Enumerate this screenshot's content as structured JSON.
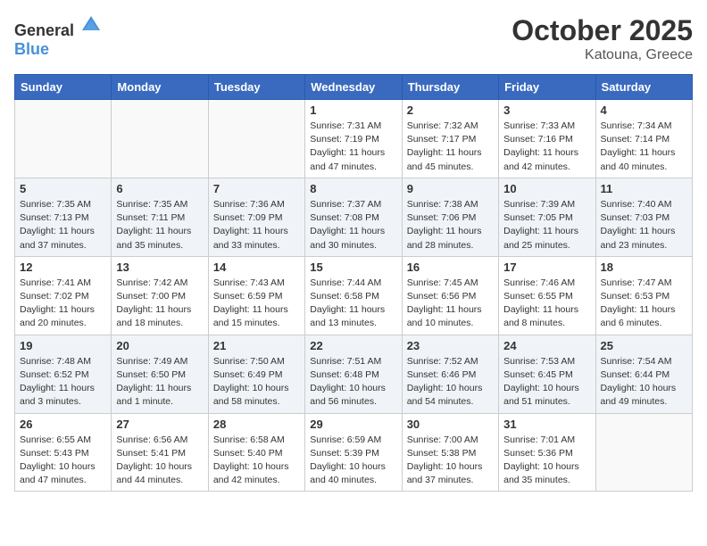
{
  "header": {
    "logo_general": "General",
    "logo_blue": "Blue",
    "month": "October 2025",
    "location": "Katouna, Greece"
  },
  "weekdays": [
    "Sunday",
    "Monday",
    "Tuesday",
    "Wednesday",
    "Thursday",
    "Friday",
    "Saturday"
  ],
  "weeks": [
    [
      {
        "day": "",
        "detail": ""
      },
      {
        "day": "",
        "detail": ""
      },
      {
        "day": "",
        "detail": ""
      },
      {
        "day": "1",
        "detail": "Sunrise: 7:31 AM\nSunset: 7:19 PM\nDaylight: 11 hours\nand 47 minutes."
      },
      {
        "day": "2",
        "detail": "Sunrise: 7:32 AM\nSunset: 7:17 PM\nDaylight: 11 hours\nand 45 minutes."
      },
      {
        "day": "3",
        "detail": "Sunrise: 7:33 AM\nSunset: 7:16 PM\nDaylight: 11 hours\nand 42 minutes."
      },
      {
        "day": "4",
        "detail": "Sunrise: 7:34 AM\nSunset: 7:14 PM\nDaylight: 11 hours\nand 40 minutes."
      }
    ],
    [
      {
        "day": "5",
        "detail": "Sunrise: 7:35 AM\nSunset: 7:13 PM\nDaylight: 11 hours\nand 37 minutes."
      },
      {
        "day": "6",
        "detail": "Sunrise: 7:35 AM\nSunset: 7:11 PM\nDaylight: 11 hours\nand 35 minutes."
      },
      {
        "day": "7",
        "detail": "Sunrise: 7:36 AM\nSunset: 7:09 PM\nDaylight: 11 hours\nand 33 minutes."
      },
      {
        "day": "8",
        "detail": "Sunrise: 7:37 AM\nSunset: 7:08 PM\nDaylight: 11 hours\nand 30 minutes."
      },
      {
        "day": "9",
        "detail": "Sunrise: 7:38 AM\nSunset: 7:06 PM\nDaylight: 11 hours\nand 28 minutes."
      },
      {
        "day": "10",
        "detail": "Sunrise: 7:39 AM\nSunset: 7:05 PM\nDaylight: 11 hours\nand 25 minutes."
      },
      {
        "day": "11",
        "detail": "Sunrise: 7:40 AM\nSunset: 7:03 PM\nDaylight: 11 hours\nand 23 minutes."
      }
    ],
    [
      {
        "day": "12",
        "detail": "Sunrise: 7:41 AM\nSunset: 7:02 PM\nDaylight: 11 hours\nand 20 minutes."
      },
      {
        "day": "13",
        "detail": "Sunrise: 7:42 AM\nSunset: 7:00 PM\nDaylight: 11 hours\nand 18 minutes."
      },
      {
        "day": "14",
        "detail": "Sunrise: 7:43 AM\nSunset: 6:59 PM\nDaylight: 11 hours\nand 15 minutes."
      },
      {
        "day": "15",
        "detail": "Sunrise: 7:44 AM\nSunset: 6:58 PM\nDaylight: 11 hours\nand 13 minutes."
      },
      {
        "day": "16",
        "detail": "Sunrise: 7:45 AM\nSunset: 6:56 PM\nDaylight: 11 hours\nand 10 minutes."
      },
      {
        "day": "17",
        "detail": "Sunrise: 7:46 AM\nSunset: 6:55 PM\nDaylight: 11 hours\nand 8 minutes."
      },
      {
        "day": "18",
        "detail": "Sunrise: 7:47 AM\nSunset: 6:53 PM\nDaylight: 11 hours\nand 6 minutes."
      }
    ],
    [
      {
        "day": "19",
        "detail": "Sunrise: 7:48 AM\nSunset: 6:52 PM\nDaylight: 11 hours\nand 3 minutes."
      },
      {
        "day": "20",
        "detail": "Sunrise: 7:49 AM\nSunset: 6:50 PM\nDaylight: 11 hours\nand 1 minute."
      },
      {
        "day": "21",
        "detail": "Sunrise: 7:50 AM\nSunset: 6:49 PM\nDaylight: 10 hours\nand 58 minutes."
      },
      {
        "day": "22",
        "detail": "Sunrise: 7:51 AM\nSunset: 6:48 PM\nDaylight: 10 hours\nand 56 minutes."
      },
      {
        "day": "23",
        "detail": "Sunrise: 7:52 AM\nSunset: 6:46 PM\nDaylight: 10 hours\nand 54 minutes."
      },
      {
        "day": "24",
        "detail": "Sunrise: 7:53 AM\nSunset: 6:45 PM\nDaylight: 10 hours\nand 51 minutes."
      },
      {
        "day": "25",
        "detail": "Sunrise: 7:54 AM\nSunset: 6:44 PM\nDaylight: 10 hours\nand 49 minutes."
      }
    ],
    [
      {
        "day": "26",
        "detail": "Sunrise: 6:55 AM\nSunset: 5:43 PM\nDaylight: 10 hours\nand 47 minutes."
      },
      {
        "day": "27",
        "detail": "Sunrise: 6:56 AM\nSunset: 5:41 PM\nDaylight: 10 hours\nand 44 minutes."
      },
      {
        "day": "28",
        "detail": "Sunrise: 6:58 AM\nSunset: 5:40 PM\nDaylight: 10 hours\nand 42 minutes."
      },
      {
        "day": "29",
        "detail": "Sunrise: 6:59 AM\nSunset: 5:39 PM\nDaylight: 10 hours\nand 40 minutes."
      },
      {
        "day": "30",
        "detail": "Sunrise: 7:00 AM\nSunset: 5:38 PM\nDaylight: 10 hours\nand 37 minutes."
      },
      {
        "day": "31",
        "detail": "Sunrise: 7:01 AM\nSunset: 5:36 PM\nDaylight: 10 hours\nand 35 minutes."
      },
      {
        "day": "",
        "detail": ""
      }
    ]
  ]
}
